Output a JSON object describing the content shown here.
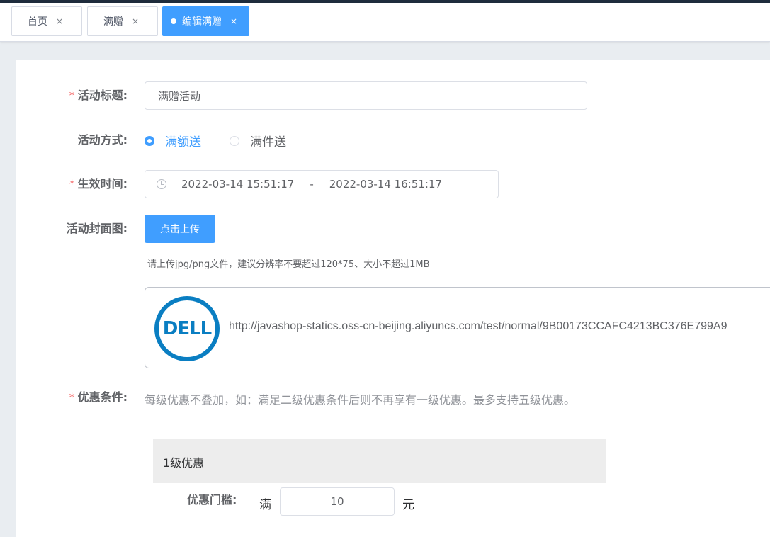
{
  "tabs": [
    {
      "label": "首页",
      "close": "×",
      "active": false
    },
    {
      "label": "满赠",
      "close": "×",
      "active": false
    },
    {
      "label": "编辑满赠",
      "close": "×",
      "active": true
    }
  ],
  "form": {
    "required_mark": "*",
    "title_label": "活动标题:",
    "title_value": "满赠活动",
    "method_label": "活动方式:",
    "method_options": [
      "满额送",
      "满件送"
    ],
    "method_selected": "满额送",
    "time_label": "生效时间:",
    "time_start": "2022-03-14 15:51:17",
    "time_separator": "-",
    "time_end": "2022-03-14 16:51:17",
    "cover_label": "活动封面图:",
    "upload_button": "点击上传",
    "upload_tip": "请上传jpg/png文件，建议分辨率不要超过120*75、大小不超过1MB",
    "file_logo_text": "DELL",
    "file_url": "http://javashop-statics.oss-cn-beijing.aliyuncs.com/test/normal/9B00173CCAFC4213BC376E799A9",
    "discount_label": "优惠条件:",
    "discount_hint": "每级优惠不叠加，如：满足二级优惠条件后则不再享有一级优惠。最多支持五级优惠。",
    "level_title": "1级优惠",
    "threshold_label": "优惠门槛:",
    "threshold_prefix": "满",
    "threshold_value": "10",
    "threshold_suffix": "元"
  },
  "colors": {
    "primary": "#409eff",
    "required": "#f56c6c",
    "dell_blue": "#0a7ec2"
  }
}
